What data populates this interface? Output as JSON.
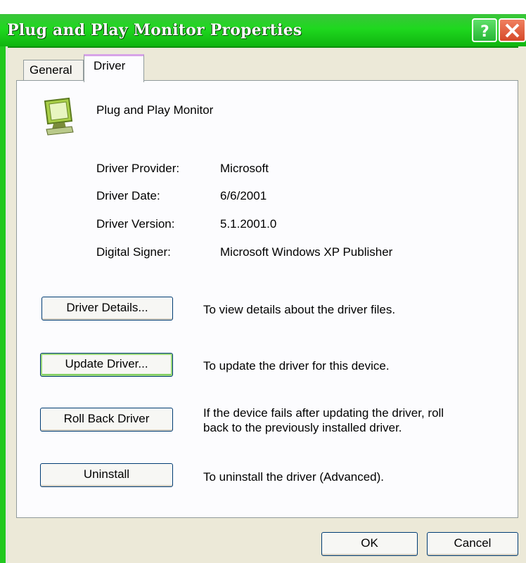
{
  "window": {
    "title": "Plug and Play Monitor Properties"
  },
  "tabs": [
    {
      "label": "General"
    },
    {
      "label": "Driver"
    }
  ],
  "device": {
    "name": "Plug and Play Monitor",
    "icon": "monitor-icon"
  },
  "driver_info": [
    {
      "label": "Driver Provider:",
      "value": "Microsoft"
    },
    {
      "label": "Driver Date:",
      "value": "6/6/2001"
    },
    {
      "label": "Driver Version:",
      "value": "5.1.2001.0"
    },
    {
      "label": "Digital Signer:",
      "value": "Microsoft Windows XP Publisher"
    }
  ],
  "actions": [
    {
      "button": "Driver Details...",
      "description": "To view details about the driver files."
    },
    {
      "button": "Update Driver...",
      "description": "To update the driver for this device."
    },
    {
      "button": "Roll Back Driver",
      "description_line1": "If the device fails after updating the driver, roll",
      "description_line2": "back to the previously installed driver."
    },
    {
      "button": "Uninstall",
      "description": "To uninstall the driver (Advanced)."
    }
  ],
  "footer": {
    "ok_label": "OK",
    "cancel_label": "Cancel"
  },
  "colors": {
    "titlebar": "#1fd81f",
    "panel": "#fcfcfe",
    "dialog_bg": "#ece9d8",
    "tab_highlight": "#d7a3e8"
  }
}
